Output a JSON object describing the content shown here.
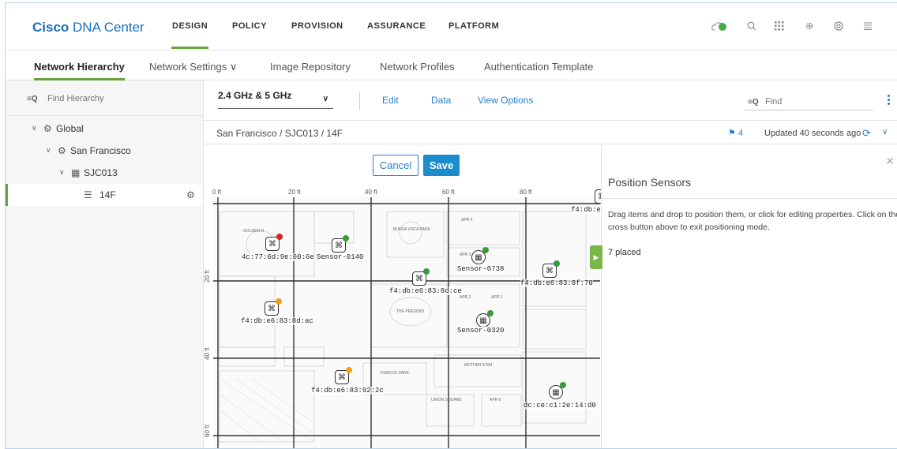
{
  "brand": {
    "strong": "Cisco",
    "light": " DNA Center"
  },
  "topnav": {
    "tabs": [
      {
        "label": "DESIGN",
        "active": true
      },
      {
        "label": "POLICY"
      },
      {
        "label": "PROVISION"
      },
      {
        "label": "ASSURANCE"
      },
      {
        "label": "PLATFORM"
      }
    ],
    "icons": [
      "cloud-status-icon",
      "search-icon",
      "apps-grid-icon",
      "settings-icon",
      "help-icon",
      "menu-icon"
    ]
  },
  "subnav": {
    "tabs": [
      {
        "label": "Network Hierarchy",
        "active": true
      },
      {
        "label": "Network Settings ∨"
      },
      {
        "label": "Image Repository"
      },
      {
        "label": "Network Profiles"
      },
      {
        "label": "Authentication Template"
      }
    ]
  },
  "hierarchy": {
    "search_placeholder": "Find Hierarchy",
    "nodes": [
      {
        "label": "Global"
      },
      {
        "label": "San Francisco"
      },
      {
        "label": "SJC013"
      },
      {
        "label": "14F",
        "selected": true
      }
    ]
  },
  "toolbar": {
    "band": "2.4 GHz & 5 GHz",
    "links": [
      "Edit",
      "Data",
      "View Options"
    ],
    "find_placeholder": "Find"
  },
  "crumbs": {
    "path": "San Francisco / SJC013 / 14F",
    "flag_count": "4",
    "updated": "Updated 40 seconds ago"
  },
  "map": {
    "cancel": "Cancel",
    "save": "Save",
    "ruler_x": [
      "0 ft",
      "20 ft",
      "40 ft",
      "60 ft",
      "80 ft"
    ],
    "ruler_y": [
      "20 ft",
      "40 ft",
      "60 ft"
    ],
    "sensors": [
      {
        "label": "4c:77:6d:9e:60:6e",
        "status": "#e02020"
      },
      {
        "label": "Sensor-0140",
        "status": "#3a9a3a"
      },
      {
        "label": "Sensor-0738",
        "status": "#3a9a3a"
      },
      {
        "label": "f4:db:e6:83:8d:ce",
        "status": "#3a9a3a"
      },
      {
        "label": "f4:db:e6:83:8f:70",
        "status": "#3a9a3a"
      },
      {
        "label": "f4:db:e6:83:8d:ac",
        "status": "#f0a020"
      },
      {
        "label": "Sensor-0320",
        "status": "#3a9a3a"
      },
      {
        "label": "f4:db:e6:83:92:2c",
        "status": "#f0a020"
      },
      {
        "label": "dc:ce:c1:2e:14:d0",
        "status": "#3a9a3a"
      },
      {
        "label": "f4:db:e6:8"
      }
    ],
    "rooms": [
      "GOLDEN G",
      "BUENA VISTA PARK",
      "APR 4",
      "THE PRESIDIO",
      "DUBOCE PARK",
      "MOTHER'S RM",
      "UNION SQUARE",
      "APR 6",
      "APR 3",
      "APR 1",
      "APR 2"
    ]
  },
  "panel": {
    "title": "Position Sensors",
    "description": "Drag items and drop to position them, or click for editing properties. Click on the cross button above to exit positioning mode.",
    "placed": "7 placed"
  },
  "colors": {
    "accent": "#6aa23e",
    "link": "#2a7fc9",
    "brand": "#1a6fb7"
  }
}
